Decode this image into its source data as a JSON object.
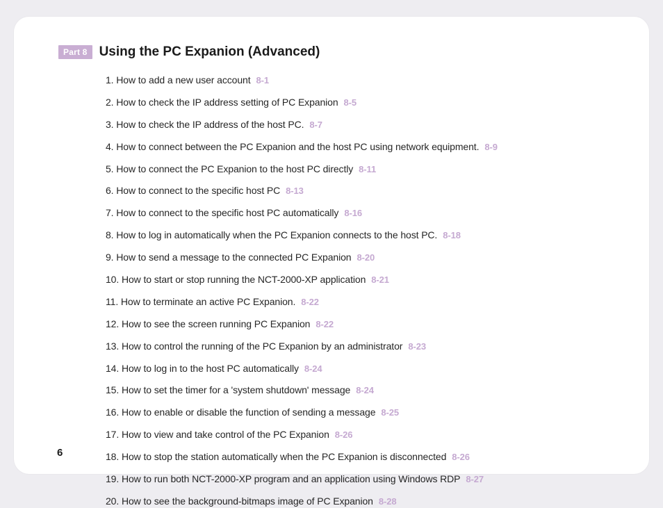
{
  "partBadge": "Part 8",
  "sectionTitle": "Using the PC Expanion (Advanced)",
  "pageNumber": "6",
  "toc": [
    {
      "text": "1. How to add a new user account",
      "ref": "8-1"
    },
    {
      "text": "2. How to check the IP address setting of PC Expanion",
      "ref": "8-5"
    },
    {
      "text": "3. How to check the IP address of the host PC.",
      "ref": "8-7"
    },
    {
      "text": "4. How to connect between the PC Expanion and the host PC using network equipment.",
      "ref": "8-9"
    },
    {
      "text": "5. How to connect the PC Expanion to the host PC directly",
      "ref": "8-11"
    },
    {
      "text": "6. How to connect to the specific host PC",
      "ref": "8-13"
    },
    {
      "text": "7. How to connect to the specific host PC automatically",
      "ref": "8-16"
    },
    {
      "text": "8. How to log in automatically when the PC Expanion connects to the host PC.",
      "ref": "8-18"
    },
    {
      "text": "9. How to send a message to the connected PC Expanion",
      "ref": "8-20"
    },
    {
      "text": "10. How to start or stop running the NCT-2000-XP application",
      "ref": "8-21"
    },
    {
      "text": "11. How to terminate an active PC Expanion.",
      "ref": "8-22"
    },
    {
      "text": "12. How to see the screen running PC Expanion",
      "ref": "8-22"
    },
    {
      "text": "13. How to control the running of the PC Expanion by an administrator",
      "ref": "8-23"
    },
    {
      "text": "14. How to log in to the host PC automatically",
      "ref": "8-24"
    },
    {
      "text": "15. How to set the timer for a 'system shutdown' message",
      "ref": "8-24"
    },
    {
      "text": "16. How to enable or disable the function of sending a message",
      "ref": "8-25"
    },
    {
      "text": "17. How to view and take control of the PC Expanion",
      "ref": "8-26"
    },
    {
      "text": "18. How to stop the station automatically when the PC Expanion is disconnected",
      "ref": "8-26"
    },
    {
      "text": "19. How to run both NCT-2000-XP program and an application using Windows RDP",
      "ref": "8-27"
    },
    {
      "text": "20. How to see the background-bitmaps image of PC Expanion",
      "ref": "8-28"
    }
  ]
}
